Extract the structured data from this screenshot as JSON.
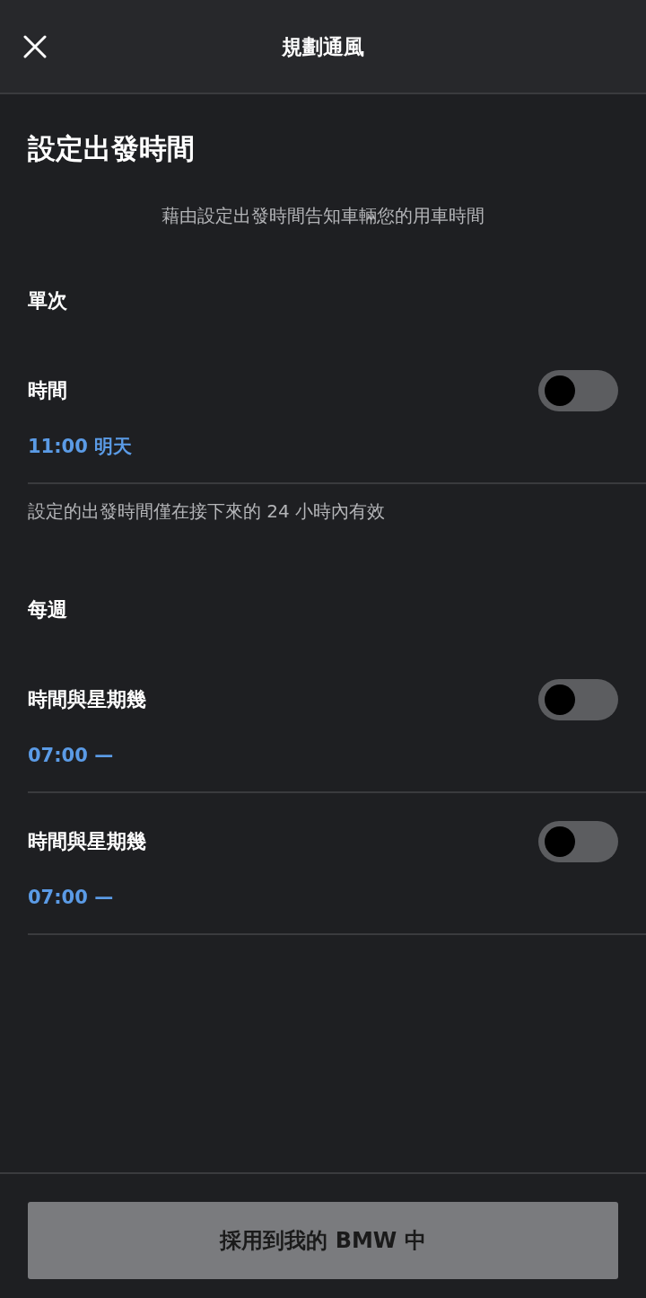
{
  "header": {
    "title": "規劃通風"
  },
  "heading": "設定出發時間",
  "subtitle": "藉由設定出發時間告知車輛您的用車時間",
  "sections": [
    {
      "title": "單次",
      "items": [
        {
          "label": "時間",
          "time": "11:00 明天",
          "on": false
        }
      ],
      "note": "設定的出發時間僅在接下來的 24 小時內有效"
    },
    {
      "title": "每週",
      "items": [
        {
          "label": "時間與星期幾",
          "time": "07:00 —",
          "on": false
        },
        {
          "label": "時間與星期幾",
          "time": "07:00 —",
          "on": false
        }
      ]
    }
  ],
  "apply_button": "採用到我的 BMW 中"
}
